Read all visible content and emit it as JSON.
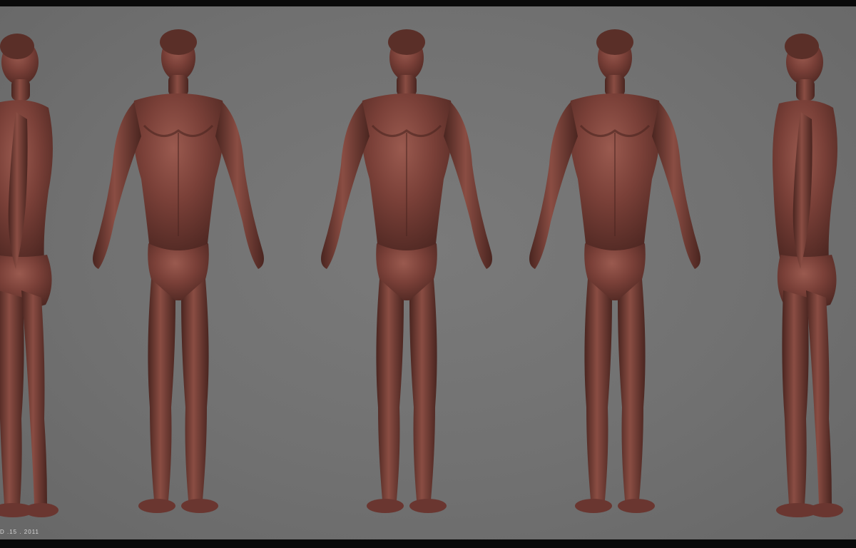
{
  "scene": {
    "caption": "D .15 . 2011",
    "background_color": "#727272",
    "frame_color": "#0a0a0a",
    "figure_color": "#6e3a32",
    "figure_highlight": "#9a5a4f",
    "figure_shadow": "#3e1f1a",
    "views": [
      "left-side-view",
      "three-quarter-front-left-view",
      "front-view",
      "three-quarter-front-right-view",
      "back-three-quarter-view"
    ]
  }
}
